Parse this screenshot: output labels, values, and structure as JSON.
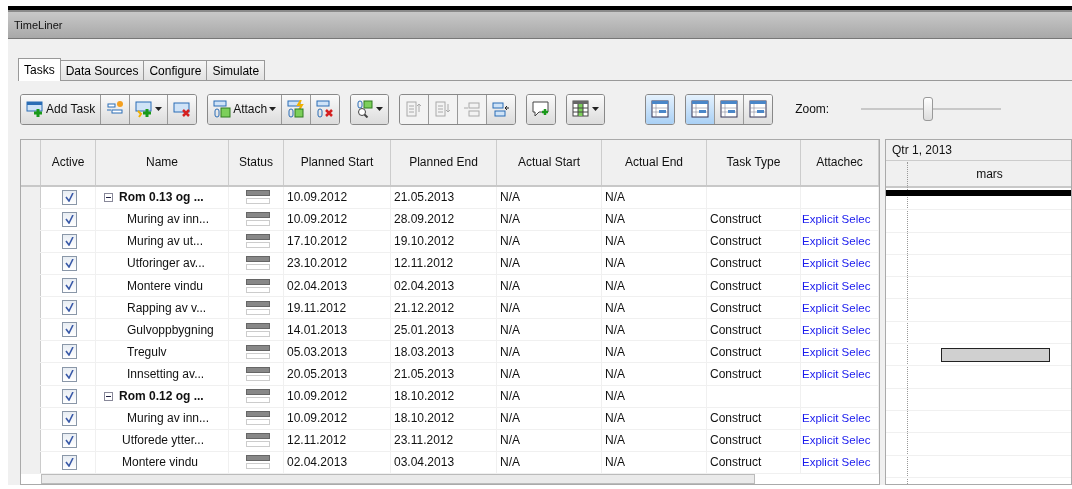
{
  "window": {
    "title": "TimeLiner"
  },
  "tabs": [
    {
      "label": "Tasks",
      "selected": true
    },
    {
      "label": "Data Sources",
      "selected": false
    },
    {
      "label": "Configure",
      "selected": false
    },
    {
      "label": "Simulate",
      "selected": false
    }
  ],
  "toolbar": {
    "groups": [
      [
        {
          "label": "Add Task",
          "dropdown": false,
          "disabled": false
        },
        {
          "dropdown": false,
          "disabled": false
        },
        {
          "dropdown": true,
          "disabled": false
        },
        {
          "dropdown": false,
          "disabled": false
        }
      ],
      [
        {
          "label": "Attach",
          "dropdown": true,
          "disabled": false
        },
        {
          "dropdown": false,
          "disabled": false
        },
        {
          "dropdown": false,
          "disabled": false
        }
      ],
      [
        {
          "dropdown": true,
          "disabled": false
        }
      ],
      [
        {
          "dropdown": false,
          "disabled": true
        },
        {
          "dropdown": false,
          "disabled": true
        },
        {
          "dropdown": false,
          "disabled": true
        },
        {
          "dropdown": false,
          "disabled": false
        }
      ],
      [
        {
          "dropdown": false,
          "disabled": false
        }
      ],
      [
        {
          "dropdown": true,
          "disabled": false
        }
      ]
    ],
    "views": [
      [
        {
          "selected": true
        }
      ],
      [
        {
          "selected": true
        },
        {
          "selected": false
        },
        {
          "selected": false
        }
      ]
    ],
    "zoom": {
      "label": "Zoom:",
      "level": 0.48
    }
  },
  "table": {
    "columns": [
      "Active",
      "Name",
      "Status",
      "Planned Start",
      "Planned End",
      "Actual Start",
      "Actual End",
      "Task Type",
      "Attachec"
    ],
    "tasks": [
      {
        "active": true,
        "name": "Rom 0.13 og ...",
        "expanded": true,
        "planned_start": "10.09.2012",
        "planned_end": "21.05.2013",
        "actual_start": "N/A",
        "actual_end": "N/A",
        "children": [
          {
            "active": true,
            "name": "Muring av inn...",
            "planned_start": "10.09.2012",
            "planned_end": "28.09.2012",
            "actual_start": "N/A",
            "actual_end": "N/A",
            "task_type": "Construct",
            "attached": "Explicit Selec"
          },
          {
            "active": true,
            "name": "Muring av ut...",
            "planned_start": "17.10.2012",
            "planned_end": "19.10.2012",
            "actual_start": "N/A",
            "actual_end": "N/A",
            "task_type": "Construct",
            "attached": "Explicit Selec"
          },
          {
            "active": true,
            "name": "Utforinger av...",
            "planned_start": "23.10.2012",
            "planned_end": "12.11.2012",
            "actual_start": "N/A",
            "actual_end": "N/A",
            "task_type": "Construct",
            "attached": "Explicit Selec"
          },
          {
            "active": true,
            "name": "Montere vindu",
            "planned_start": "02.04.2013",
            "planned_end": "02.04.2013",
            "actual_start": "N/A",
            "actual_end": "N/A",
            "task_type": "Construct",
            "attached": "Explicit Selec"
          },
          {
            "active": true,
            "name": "Rapping av v...",
            "planned_start": "19.11.2012",
            "planned_end": "21.12.2012",
            "actual_start": "N/A",
            "actual_end": "N/A",
            "task_type": "Construct",
            "attached": "Explicit Selec"
          },
          {
            "active": true,
            "name": "Gulvoppbygning",
            "planned_start": "14.01.2013",
            "planned_end": "25.01.2013",
            "actual_start": "N/A",
            "actual_end": "N/A",
            "task_type": "Construct",
            "attached": "Explicit Selec"
          },
          {
            "active": true,
            "name": "Tregulv",
            "planned_start": "05.03.2013",
            "planned_end": "18.03.2013",
            "actual_start": "N/A",
            "actual_end": "N/A",
            "task_type": "Construct",
            "attached": "Explicit Selec"
          },
          {
            "active": true,
            "name": "Innsetting av...",
            "planned_start": "20.05.2013",
            "planned_end": "21.05.2013",
            "actual_start": "N/A",
            "actual_end": "N/A",
            "task_type": "Construct",
            "attached": "Explicit Selec"
          }
        ]
      },
      {
        "active": true,
        "name": "Rom 0.12 og ...",
        "expanded": true,
        "planned_start": "10.09.2012",
        "planned_end": "18.10.2012",
        "actual_start": "N/A",
        "actual_end": "N/A",
        "children": [
          {
            "active": true,
            "name": "Muring av inn...",
            "planned_start": "10.09.2012",
            "planned_end": "18.10.2012",
            "actual_start": "N/A",
            "actual_end": "N/A",
            "task_type": "Construct",
            "attached": "Explicit Selec"
          }
        ]
      },
      {
        "active": true,
        "name": "Utforede ytter...",
        "planned_start": "12.11.2012",
        "planned_end": "23.11.2012",
        "actual_start": "N/A",
        "actual_end": "N/A",
        "task_type": "Construct",
        "attached": "Explicit Selec"
      },
      {
        "active": true,
        "name": "Montere vindu",
        "planned_start": "02.04.2013",
        "planned_end": "03.04.2013",
        "actual_start": "N/A",
        "actual_end": "N/A",
        "task_type": "Construct",
        "attached": "Explicit Selec"
      }
    ]
  },
  "gantt": {
    "period": "Qtr 1, 2013",
    "month": "mars"
  }
}
